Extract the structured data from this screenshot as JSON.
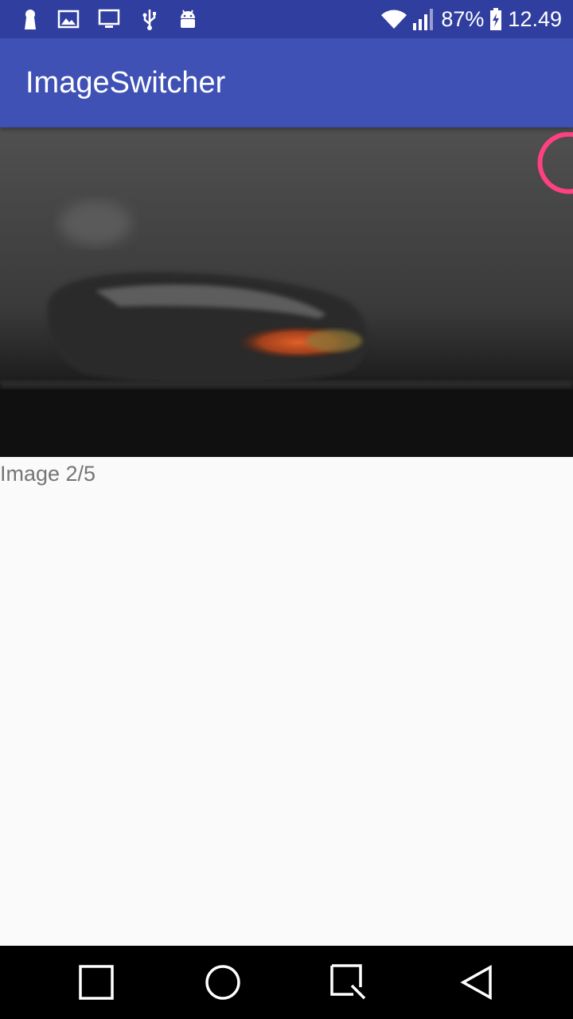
{
  "status_bar": {
    "left_icons": [
      "keyhole-icon",
      "image-icon",
      "monitor-icon",
      "usb-icon",
      "android-icon"
    ],
    "battery_percent": "87%",
    "time": "12.49",
    "color": "#303f9f"
  },
  "app_bar": {
    "title": "ImageSwitcher",
    "color": "#3f51b5"
  },
  "image_switcher": {
    "caption": "Image 2/5",
    "spinner_color": "#ff4081"
  },
  "nav_bar": {
    "buttons": [
      "recents-square-icon",
      "home-circle-icon",
      "search-square-icon",
      "back-triangle-icon"
    ]
  }
}
